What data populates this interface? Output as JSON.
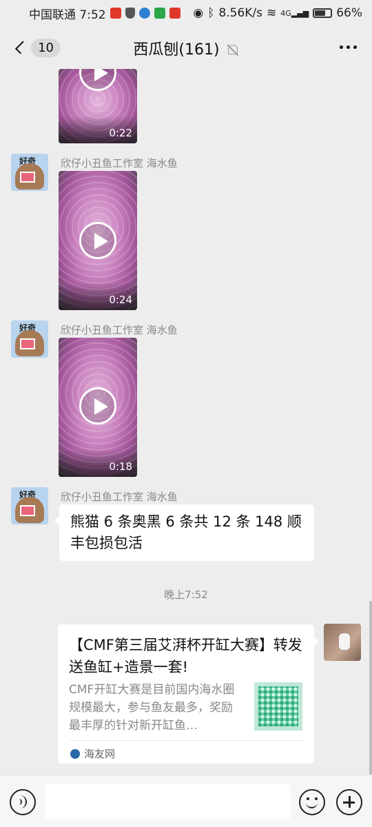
{
  "status_bar": {
    "carrier_time": "中国联通 7:52",
    "network_speed": "8.56K/s",
    "network_type": "4G",
    "battery_percent": "66%",
    "battery_level": 0.66
  },
  "header": {
    "back_count": "10",
    "title": "西瓜刨(161)",
    "muted": true
  },
  "messages": [
    {
      "type": "video",
      "duration": "0:22"
    },
    {
      "type": "video",
      "sender": "欣仔小丑鱼工作室 海水鱼",
      "duration": "0:24"
    },
    {
      "type": "video",
      "sender": "欣仔小丑鱼工作室 海水鱼",
      "duration": "0:18"
    },
    {
      "type": "text",
      "sender": "欣仔小丑鱼工作室 海水鱼",
      "text": "熊猫 6 条奥黑 6 条共 12 条 148 顺丰包损包活"
    }
  ],
  "timestamp": "晚上7:52",
  "link_card": {
    "title": "【CMF第三届艾湃杯开缸大赛】转发送鱼缸+造景一套!",
    "description": "CMF开缸大赛是目前国内海水圈规模最大，参与鱼友最多，奖励最丰厚的针对新开缸鱼…",
    "source": "海友网"
  },
  "input": {
    "placeholder": ""
  },
  "colors": {
    "background": "#ededed",
    "bubble": "#ffffff",
    "secondary_text": "#888888"
  }
}
